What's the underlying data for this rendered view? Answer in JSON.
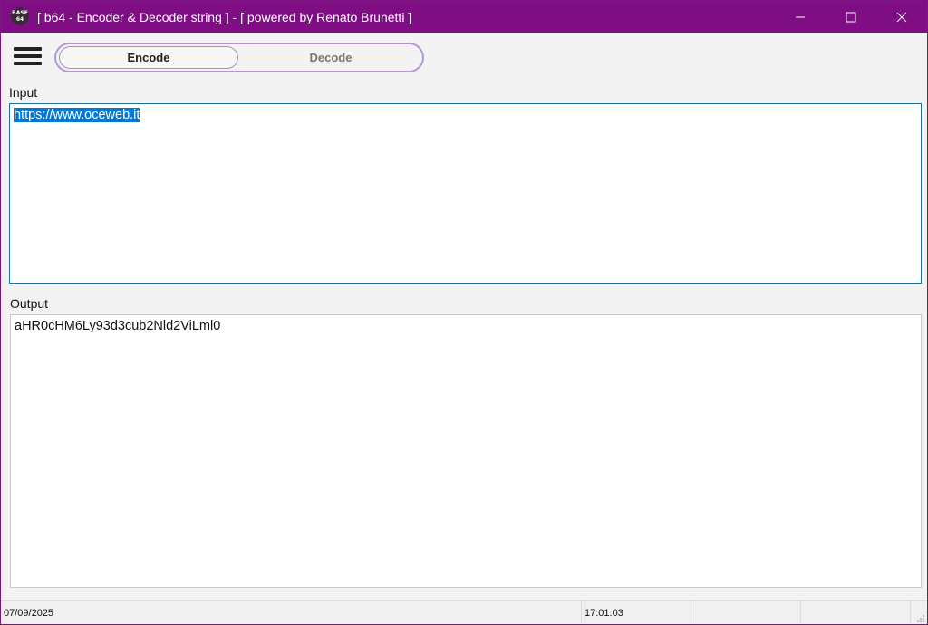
{
  "window": {
    "icon_label": "BASE 64",
    "title": "[ b64 - Encoder & Decoder string ] - [ powered by Renato Brunetti ]",
    "controls": {
      "minimize": "minimize-icon",
      "maximize": "maximize-icon",
      "close": "close-icon"
    }
  },
  "toolbar": {
    "menu_icon": "hamburger-menu-icon",
    "modes": [
      {
        "label": "Encode",
        "selected": true
      },
      {
        "label": "Decode",
        "selected": false
      }
    ]
  },
  "input": {
    "label": "Input",
    "value": "https://www.oceweb.it",
    "text_selected": true
  },
  "output": {
    "label": "Output",
    "value": "aHR0cHM6Ly93d3cub2Nld2ViLml0"
  },
  "statusbar": {
    "date": "07/09/2025",
    "time": "17:01:03"
  },
  "colors": {
    "titlebar": "#7f0d84",
    "selection": "#0078d7",
    "toggle_border": "#b497cf"
  }
}
